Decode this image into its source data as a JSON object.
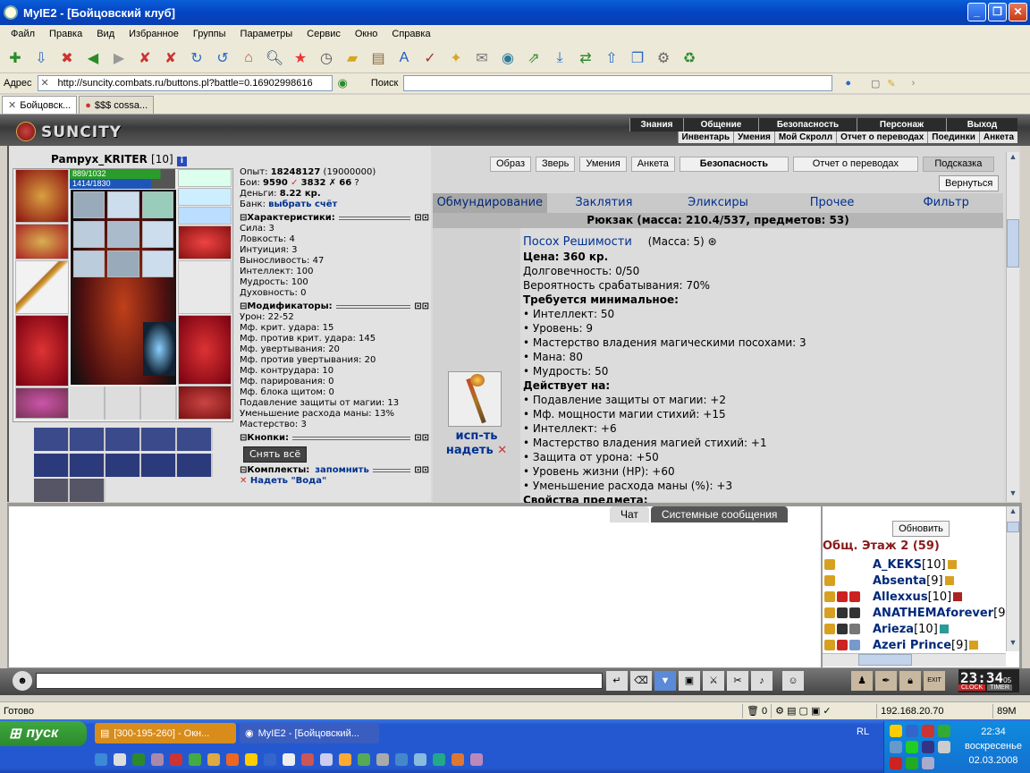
{
  "window": {
    "title": "MyIE2 - [Бойцовский клуб]"
  },
  "menu": [
    "Файл",
    "Правка",
    "Вид",
    "Избранное",
    "Группы",
    "Параметры",
    "Сервис",
    "Окно",
    "Справка"
  ],
  "address": {
    "label": "Адрес",
    "url": "http://suncity.combats.ru/buttons.pl?battle=0.16902998616",
    "search_label": "Поиск"
  },
  "browser_tabs": [
    {
      "label": "Бойцовск..."
    },
    {
      "label": "$$$ cossa..."
    }
  ],
  "game": {
    "logo": "SUNCITY",
    "topnav": [
      "Знания",
      "Общение",
      "Безопасность",
      "Персонаж",
      "Выход"
    ],
    "subnav": [
      "Инвентарь",
      "Умения",
      "Мой Скролл",
      "Отчет о переводах",
      "Поединки",
      "Анкета"
    ],
    "character": {
      "name": "Pampyx_KRITER",
      "level": "[10]",
      "hp": "889/1032",
      "mana": "1414/1830",
      "hp_fraction": 0.861,
      "mana_fraction": 0.773
    },
    "info": {
      "exp_label": "Опыт:",
      "exp": "18248127",
      "exp_next": "(19000000)",
      "fights_label": "Бои:",
      "wins": "9590",
      "losses": "3832",
      "draws": "66",
      "money_label": "Деньги:",
      "money": "8.22 кр.",
      "bank_label": "Банк:",
      "bank_link": "выбрать счёт"
    },
    "characteristics": {
      "title": "Характеристики:",
      "rows": [
        "Сила: 3",
        "Ловкость: 4",
        "Интуиция: 3",
        "Выносливость: 47",
        "Интеллект: 100",
        "Мудрость: 100",
        "Духовность: 0"
      ]
    },
    "modifiers": {
      "title": "Модификаторы:",
      "rows": [
        "Урон: 22-52",
        "Мф. крит. удара: 15",
        "Мф. против крит. удара: 145",
        "Мф. увертывания: 20",
        "Мф. против увертывания: 20",
        "Мф. контрудара: 10",
        "Мф. парирования: 0",
        "Мф. блока щитом: 0",
        "Подавление защиты от магии: 13",
        "Уменьшение расхода маны: 13%",
        "Мастерство: 3"
      ]
    },
    "buttons_section": {
      "title": "Кнопки:",
      "remove_all": "Снять всё"
    },
    "sets_section": {
      "title": "Комплекты:",
      "remember": "запомнить",
      "wear_set": "Надеть \"Вода\""
    },
    "top_buttons": [
      "Образ",
      "Зверь",
      "Умения",
      "Анкета",
      "Безопасность",
      "Отчет о переводах",
      "Подсказка"
    ],
    "back_button": "Вернуться",
    "inv_tabs": [
      "Обмундирование",
      "Заклятия",
      "Эликсиры",
      "Прочее",
      "Фильтр"
    ],
    "backpack": "Рюкзак (масса: 210.4/537, предметов: 53)",
    "item": {
      "name": "Посох Решимости",
      "mass": "(Масса: 5)",
      "lines": [
        {
          "t": "Цена: 360 кр.",
          "b": true
        },
        {
          "t": "Долговечность: 0/50",
          "b": false
        },
        {
          "t": "Вероятность срабатывания: 70%",
          "b": false
        },
        {
          "t": "Требуется минимальное:",
          "b": true
        },
        {
          "t": "• Интеллект: 50",
          "b": false
        },
        {
          "t": "• Уровень: 9",
          "b": false
        },
        {
          "t": "• Мастерство владения магическими посохами: 3",
          "b": false
        },
        {
          "t": "• Мана: 80",
          "b": false
        },
        {
          "t": "• Мудрость: 50",
          "b": false
        },
        {
          "t": "Действует на:",
          "b": true
        },
        {
          "t": "• Подавление защиты от магии: +2",
          "b": false
        },
        {
          "t": "• Мф. мощности магии стихий: +15",
          "b": false
        },
        {
          "t": "• Интеллект: +6",
          "b": false
        },
        {
          "t": "• Мастерство владения магией стихий: +1",
          "b": false
        },
        {
          "t": "• Защита от урона: +50",
          "b": false
        },
        {
          "t": "• Уровень жизни (HP): +60",
          "b": false
        },
        {
          "t": "• Уменьшение расхода маны (%): +3",
          "b": false
        },
        {
          "t": "Свойства предмета:",
          "b": true
        }
      ],
      "use_label": "исп-ть",
      "wear_label": "надеть"
    },
    "chat_tabs": [
      "Чат",
      "Системные сообщения"
    ],
    "refresh_button": "Обновить",
    "room_title": "Общ. Этаж 2 (59)",
    "users": [
      {
        "name": "A_KEKS",
        "level": "[10]"
      },
      {
        "name": "Absenta",
        "level": "[9]"
      },
      {
        "name": "Allexxus",
        "level": "[10]"
      },
      {
        "name": "ANATHEMAforever",
        "level": "[9"
      },
      {
        "name": "Arieza",
        "level": "[10]"
      },
      {
        "name": "Azeri Prince",
        "level": "[9]"
      }
    ],
    "clock": "23:34",
    "clock_sec": "05",
    "clock_labels": [
      "CLOCK",
      "TIMER"
    ],
    "exit_label": "EXIT"
  },
  "statusbar": {
    "text": "Готово",
    "count": "0",
    "ip": "192.168.20.70",
    "mem": "89M"
  },
  "taskbar": {
    "start": "пуск",
    "tasks": [
      {
        "label": "[300-195-260] - Окн..."
      },
      {
        "label": "MyIE2 - [Бойцовский..."
      }
    ],
    "lang": "RL",
    "time": "22:34",
    "day": "воскресенье",
    "date": "02.03.2008"
  }
}
